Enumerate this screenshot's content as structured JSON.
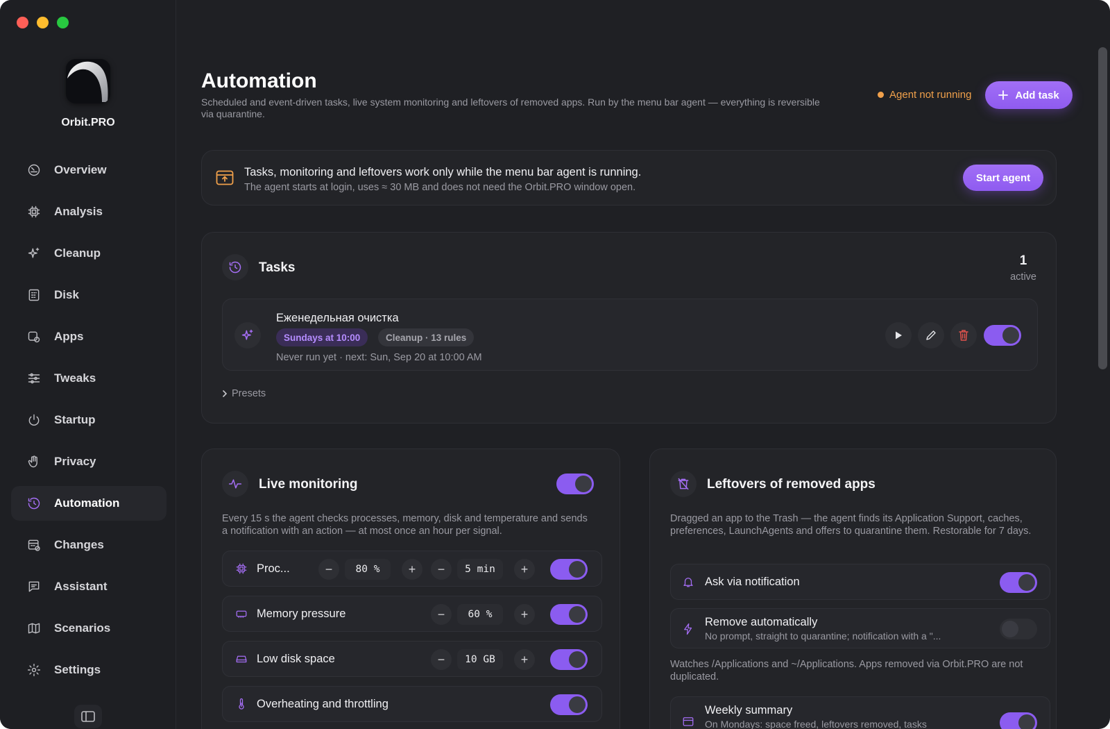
{
  "app": {
    "name": "Orbit.PRO"
  },
  "sidebar": {
    "items": [
      {
        "label": "Overview",
        "icon": "gauge-icon"
      },
      {
        "label": "Analysis",
        "icon": "chip-icon"
      },
      {
        "label": "Cleanup",
        "icon": "sparkle-icon"
      },
      {
        "label": "Disk",
        "icon": "grid-icon"
      },
      {
        "label": "Apps",
        "icon": "apps-icon"
      },
      {
        "label": "Tweaks",
        "icon": "sliders-icon"
      },
      {
        "label": "Startup",
        "icon": "power-icon"
      },
      {
        "label": "Privacy",
        "icon": "hand-icon"
      },
      {
        "label": "Automation",
        "icon": "clock-rotate-icon",
        "active": true
      },
      {
        "label": "Changes",
        "icon": "calendar-icon"
      },
      {
        "label": "Assistant",
        "icon": "chat-icon"
      },
      {
        "label": "Scenarios",
        "icon": "map-icon"
      },
      {
        "label": "Settings",
        "icon": "gear-icon"
      }
    ]
  },
  "header": {
    "title": "Automation",
    "subtitle": "Scheduled and event-driven tasks, live system monitoring and leftovers of removed apps. Run by the menu bar agent — everything is reversible via quarantine.",
    "agent_status": "Agent not running",
    "add_task_label": "Add task"
  },
  "banner": {
    "title": "Tasks, monitoring and leftovers work only while the menu bar agent is running.",
    "subtitle": "The agent starts at login, uses ≈ 30 MB and does not need the Orbit.PRO window open.",
    "button": "Start agent"
  },
  "tasks": {
    "title": "Tasks",
    "active_count": "1",
    "active_label": "active",
    "items": [
      {
        "name": "Еженедельная очистка",
        "schedule": "Sundays at 10:00",
        "rule": "Cleanup · 13 rules",
        "meta": "Never run yet  · next: Sun, Sep 20 at 10:00 AM",
        "enabled": true
      }
    ],
    "presets_label": "Presets"
  },
  "monitoring": {
    "title": "Live monitoring",
    "enabled": true,
    "description": "Every 15 s the agent checks processes, memory, disk and temperature and sends a notification with an action — at most once an hour per signal.",
    "rows": [
      {
        "label": "Proc...",
        "value1": "80 %",
        "value2": "5 min",
        "enabled": true
      },
      {
        "label": "Memory pressure",
        "value1": "60 %",
        "enabled": true
      },
      {
        "label": "Low disk space",
        "value1": "10 GB",
        "enabled": true
      },
      {
        "label": "Overheating and throttling",
        "enabled": true
      }
    ]
  },
  "leftovers": {
    "title": "Leftovers of removed apps",
    "description": "Dragged an app to the Trash — the agent finds its Application Support, caches, preferences, LaunchAgents and offers to quarantine them. Restorable for 7 days.",
    "ask": {
      "label": "Ask via notification",
      "enabled": true
    },
    "auto": {
      "label": "Remove automatically",
      "sub": "No prompt, straight to quarantine; notification with a \"...",
      "enabled": false
    },
    "watches": "Watches /Applications and ~/Applications. Apps removed via Orbit.PRO are not duplicated.",
    "weekly": {
      "label": "Weekly summary",
      "sub": "On Mondays: space freed, leftovers removed, tasks",
      "enabled": true
    }
  },
  "colors": {
    "accent": "#8b5cf0",
    "warning": "#f0a04b",
    "danger": "#e0524c"
  }
}
